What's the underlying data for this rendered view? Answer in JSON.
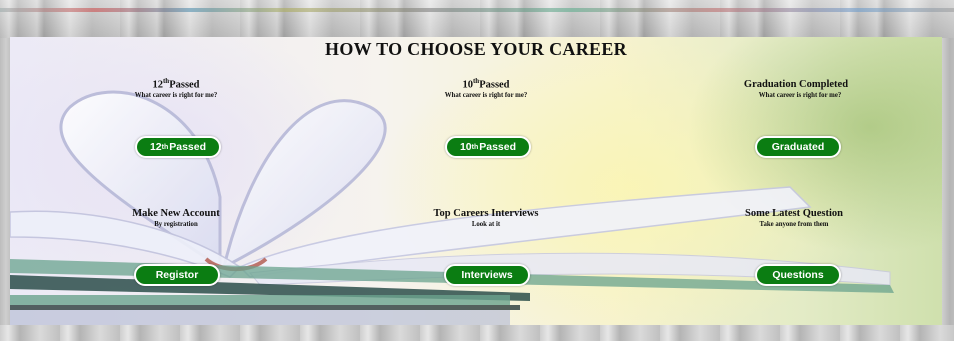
{
  "page": {
    "title": "HOW TO CHOOSE YOUR CAREER"
  },
  "cards": [
    {
      "title_prefix": "12",
      "title_sup": "th",
      "title_suffix": "Passed",
      "subtitle": "What career is right for me?",
      "button_prefix": "12",
      "button_sup": "th",
      "button_suffix": " Passed"
    },
    {
      "title_prefix": "10",
      "title_sup": "th",
      "title_suffix": "Passed",
      "subtitle": "What career is right for me?",
      "button_prefix": "10",
      "button_sup": "th",
      "button_suffix": " Passed"
    },
    {
      "title": "Graduation Completed",
      "subtitle": "What career is right for me?",
      "button": "Graduated"
    },
    {
      "title": "Make New Account",
      "subtitle": "By registration",
      "button": "Registor"
    },
    {
      "title": "Top Careers Interviews",
      "subtitle": "Look at it",
      "button": "Interviews"
    },
    {
      "title": "Some Latest Question",
      "subtitle": "Take anyone from them",
      "button": "Questions"
    }
  ],
  "colors": {
    "button_bg": "#0b7d12",
    "button_text": "#ffffff",
    "heading": "#111111"
  }
}
